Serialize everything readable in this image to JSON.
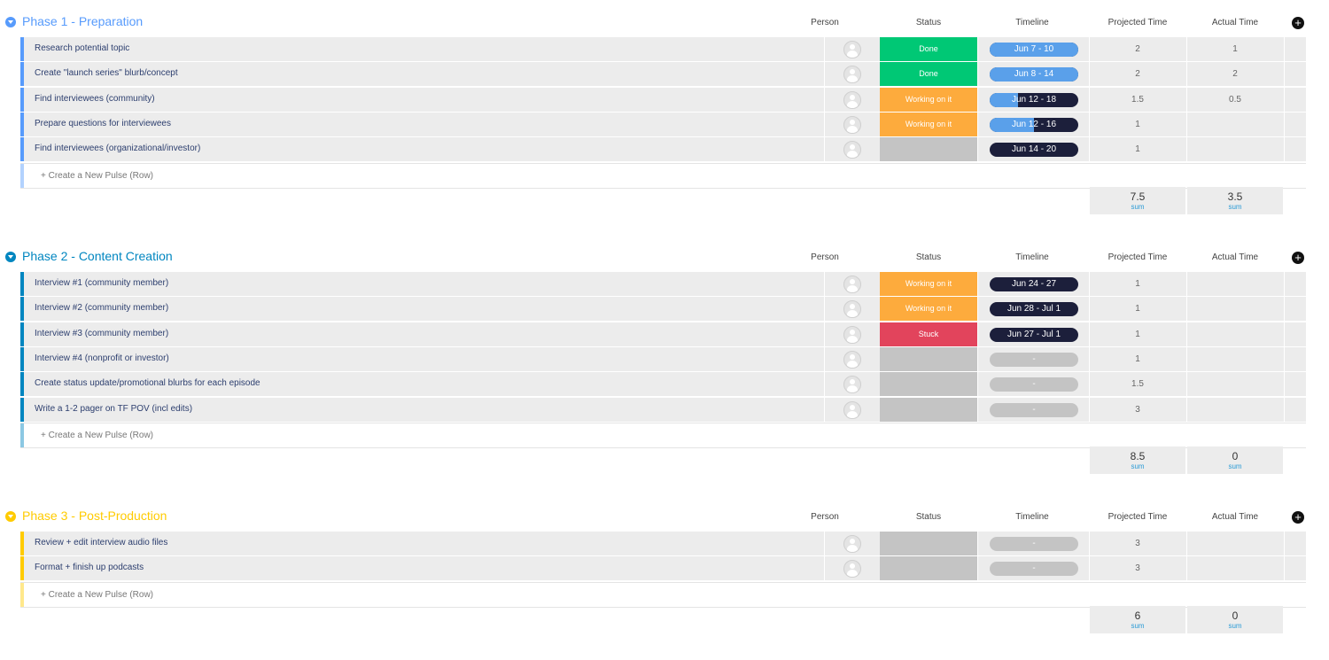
{
  "columns": {
    "person": "Person",
    "status": "Status",
    "timeline": "Timeline",
    "projected": "Projected Time",
    "actual": "Actual Time"
  },
  "new_row_label": "+ Create a New Pulse (Row)",
  "sum_label": "sum",
  "colors": {
    "done": "#00c875",
    "working": "#fdab3d",
    "stuck": "#e2445c",
    "empty": "#c4c4c4",
    "timeline_dark": "#1c1f3b",
    "timeline_light": "#5aa0ea",
    "timeline_empty": "#c4c4c4"
  },
  "groups": [
    {
      "title": "Phase 1 - Preparation",
      "color": "#579bfc",
      "totals": {
        "projected": "7.5",
        "actual": "3.5"
      },
      "rows": [
        {
          "name": "Research potential topic",
          "status": "Done",
          "status_key": "done",
          "timeline": "Jun 7 - 10",
          "progress": 1.0,
          "projected": "2",
          "actual": "1"
        },
        {
          "name": "Create \"launch series\" blurb/concept",
          "status": "Done",
          "status_key": "done",
          "timeline": "Jun 8 - 14",
          "progress": 1.0,
          "projected": "2",
          "actual": "2"
        },
        {
          "name": "Find interviewees (community)",
          "status": "Working on it",
          "status_key": "working",
          "timeline": "Jun 12 - 18",
          "progress": 0.32,
          "projected": "1.5",
          "actual": "0.5"
        },
        {
          "name": "Prepare questions for interviewees",
          "status": "Working on it",
          "status_key": "working",
          "timeline": "Jun 12 - 16",
          "progress": 0.5,
          "projected": "1",
          "actual": ""
        },
        {
          "name": "Find interviewees (organizational/investor)",
          "status": "",
          "status_key": "empty",
          "timeline": "Jun 14 - 20",
          "progress": 0,
          "projected": "1",
          "actual": ""
        }
      ]
    },
    {
      "title": "Phase 2 - Content Creation",
      "color": "#0086c0",
      "totals": {
        "projected": "8.5",
        "actual": "0"
      },
      "rows": [
        {
          "name": "Interview #1 (community member)",
          "status": "Working on it",
          "status_key": "working",
          "timeline": "Jun 24 - 27",
          "progress": 0,
          "projected": "1",
          "actual": ""
        },
        {
          "name": "Interview #2 (community member)",
          "status": "Working on it",
          "status_key": "working",
          "timeline": "Jun 28 - Jul 1",
          "progress": 0,
          "projected": "1",
          "actual": ""
        },
        {
          "name": "Interview #3 (community member)",
          "status": "Stuck",
          "status_key": "stuck",
          "timeline": "Jun 27 - Jul 1",
          "progress": 0,
          "projected": "1",
          "actual": ""
        },
        {
          "name": "Interview #4 (nonprofit or investor)",
          "status": "",
          "status_key": "empty",
          "timeline": "-",
          "progress": -1,
          "projected": "1",
          "actual": ""
        },
        {
          "name": "Create status update/promotional blurbs for each episode",
          "status": "",
          "status_key": "empty",
          "timeline": "-",
          "progress": -1,
          "projected": "1.5",
          "actual": ""
        },
        {
          "name": "Write a 1-2 pager on TF POV (incl edits)",
          "status": "",
          "status_key": "empty",
          "timeline": "-",
          "progress": -1,
          "projected": "3",
          "actual": ""
        }
      ]
    },
    {
      "title": "Phase 3 - Post-Production",
      "color": "#ffcb00",
      "totals": {
        "projected": "6",
        "actual": "0"
      },
      "rows": [
        {
          "name": "Review + edit interview audio files",
          "status": "",
          "status_key": "empty",
          "timeline": "-",
          "progress": -1,
          "projected": "3",
          "actual": ""
        },
        {
          "name": "Format + finish up podcasts",
          "status": "",
          "status_key": "empty",
          "timeline": "-",
          "progress": -1,
          "projected": "3",
          "actual": ""
        }
      ]
    }
  ]
}
